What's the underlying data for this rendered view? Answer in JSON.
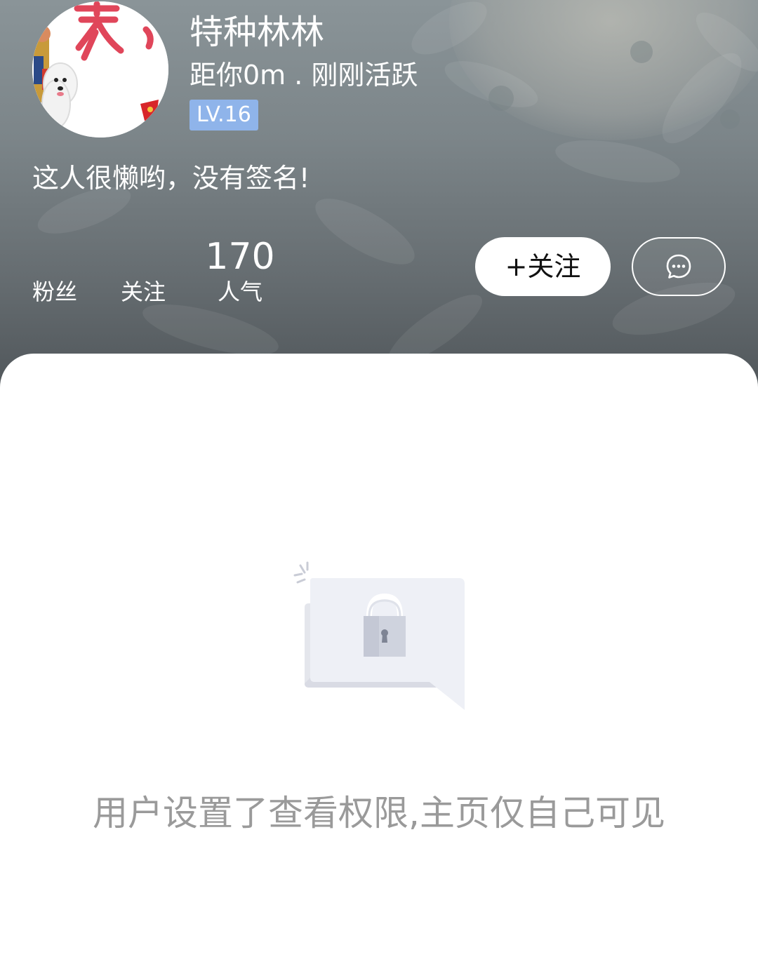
{
  "profile": {
    "username": "特种林林",
    "distance_status": "距你0m . 刚刚活跃",
    "level": "LV.16",
    "signature": "这人很懒哟，没有签名!"
  },
  "stats": {
    "fans": {
      "value": "",
      "label": "粉丝"
    },
    "following": {
      "value": "",
      "label": "关注"
    },
    "popularity": {
      "value": "170",
      "label": "人气"
    }
  },
  "actions": {
    "follow_label": "+关注",
    "message_icon": "chat-bubble-ellipsis-icon"
  },
  "empty_state": {
    "icon": "locked-message-icon",
    "message": "用户设置了查看权限,主页仅自己可见"
  },
  "colors": {
    "level_badge": "#8fb4ea",
    "private_text": "#9a9a9a",
    "header_top": "#8a9498",
    "header_bottom": "#50565a"
  }
}
